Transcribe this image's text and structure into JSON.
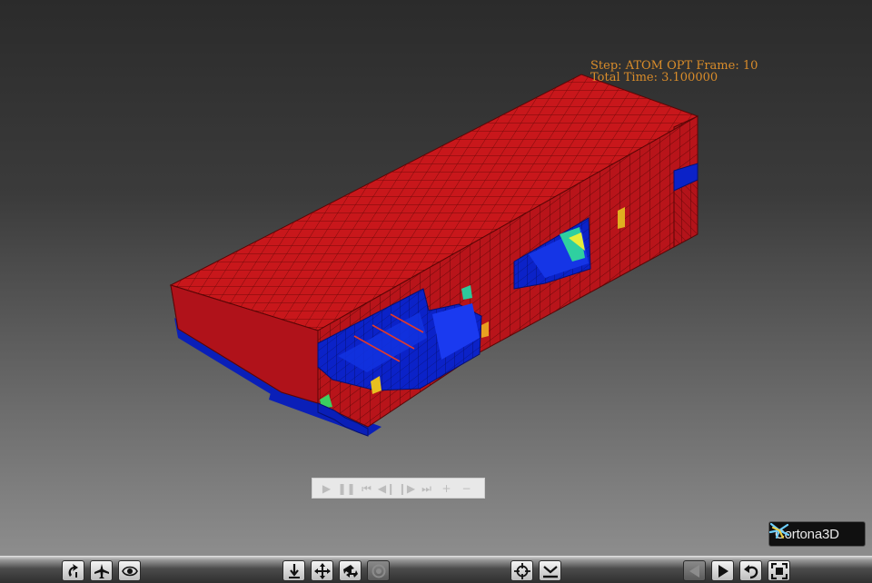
{
  "hud": {
    "step_text": "Step: ATOM OPT Frame: 10",
    "time_text": "Total Time: 3.100000"
  },
  "animation_controls": [
    {
      "name": "play",
      "glyph": "▶"
    },
    {
      "name": "pause",
      "glyph": "❚❚"
    },
    {
      "name": "rewind",
      "glyph": "⏮"
    },
    {
      "name": "step-back",
      "glyph": "◀❙"
    },
    {
      "name": "step-forward",
      "glyph": "❙▶"
    },
    {
      "name": "fast-forward",
      "glyph": "⏭"
    },
    {
      "name": "speed-up",
      "glyph": "+"
    },
    {
      "name": "slow-down",
      "glyph": "−"
    }
  ],
  "logo": {
    "text": "Cortona3D"
  },
  "toolbar_buttons": [
    {
      "name": "orbit-button",
      "icon": "orbit-icon",
      "enabled": true
    },
    {
      "name": "fly-button",
      "icon": "plane-icon",
      "enabled": true
    },
    {
      "name": "study-button",
      "icon": "eye-icon",
      "enabled": true
    },
    {
      "name": "tilt-button",
      "icon": "tilt-arrow-icon",
      "enabled": true
    },
    {
      "name": "pan-button",
      "icon": "pan-cross-icon",
      "enabled": true
    },
    {
      "name": "rotate-button",
      "icon": "rotate-icon",
      "enabled": true
    },
    {
      "name": "zoom-button",
      "icon": "zoom-target-icon",
      "enabled": false
    },
    {
      "name": "goto-button",
      "icon": "crosshair-icon",
      "enabled": true
    },
    {
      "name": "align-button",
      "icon": "align-icon",
      "enabled": true
    },
    {
      "name": "previous-viewpoint-button",
      "icon": "triangle-left-icon",
      "enabled": false
    },
    {
      "name": "next-viewpoint-button",
      "icon": "triangle-right-icon",
      "enabled": true
    },
    {
      "name": "restore-button",
      "icon": "undo-arrow-icon",
      "enabled": true
    },
    {
      "name": "fit-button",
      "icon": "fit-screen-icon",
      "enabled": true
    }
  ],
  "colors": {
    "mesh_red": "#c0161a",
    "mesh_blue": "#0b22c8",
    "hud_orange": "#d98c2a"
  }
}
